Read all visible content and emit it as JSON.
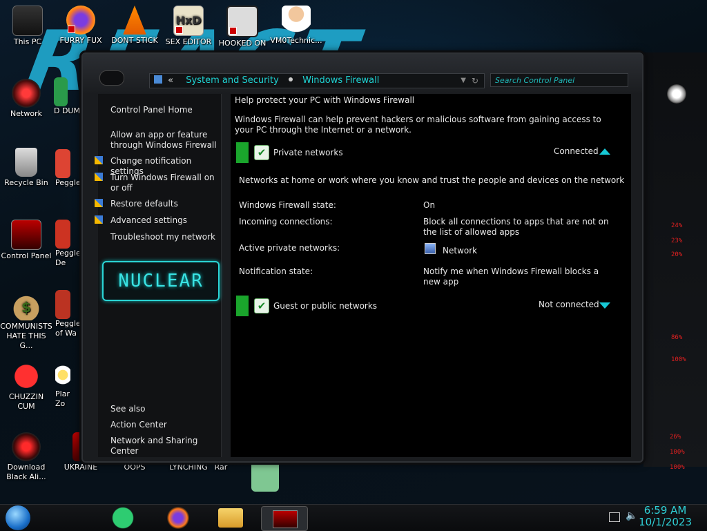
{
  "desktop": {
    "icons": [
      {
        "label": "This PC"
      },
      {
        "label": "FURRY FUX"
      },
      {
        "label": "DONT STICK"
      },
      {
        "label": "SEX EDITOR"
      },
      {
        "label": "HOOKED ON"
      },
      {
        "label": "VM0Technic..."
      },
      {
        "label": "Network"
      },
      {
        "label": "Recycle Bin"
      },
      {
        "label": "Control Panel"
      },
      {
        "label": "COMMUNISTS HATE THIS G..."
      },
      {
        "label": "CHUZZIN CUM"
      },
      {
        "label": "Download Black Ali..."
      },
      {
        "label": "UKRAINE"
      },
      {
        "label": "OOPS"
      },
      {
        "label": "LYNCHING"
      },
      {
        "label": "Rar"
      },
      {
        "label": "D DUM"
      },
      {
        "label": "Peggle"
      },
      {
        "label": "Peggle De"
      },
      {
        "label": "Peggle of Wa"
      },
      {
        "label": "Plar Zo"
      }
    ],
    "wallpaper_graffiti": "REACT"
  },
  "window": {
    "address": {
      "back_chevron": "«",
      "crumb1": "System and Security",
      "crumb2": "Windows Firewall"
    },
    "search_placeholder": "Search Control Panel",
    "sidebar": {
      "home": "Control Panel Home",
      "links": [
        "Allow an app or feature through Windows Firewall",
        "Change notification settings",
        "Turn Windows Firewall on or off",
        "Restore defaults",
        "Advanced settings",
        "Troubleshoot my network"
      ],
      "logo_text": "NUCLEAR",
      "see_also": "See also",
      "see_also_links": [
        "Action Center",
        "Network and Sharing Center"
      ]
    },
    "main": {
      "heading": "Help protect your PC with Windows Firewall",
      "description": "Windows Firewall can help prevent hackers or malicious software from gaining access to your PC through the Internet or a network.",
      "private": {
        "title": "Private networks",
        "status": "Connected",
        "summary": "Networks at home or work where you know and trust the people and devices on the network",
        "rows": [
          {
            "label": "Windows Firewall state:",
            "value": "On"
          },
          {
            "label": "Incoming connections:",
            "value": "Block all connections to apps that are not on the list of allowed apps"
          },
          {
            "label": "Active private networks:",
            "value": "Network"
          },
          {
            "label": "Notification state:",
            "value": "Notify me when Windows Firewall blocks a new app"
          }
        ]
      },
      "public": {
        "title": "Guest or public networks",
        "status": "Not connected"
      }
    }
  },
  "right_widgets": {
    "readouts": [
      "24%",
      "23%",
      "20%",
      "86%",
      "100%",
      "26%",
      "100%",
      "100%"
    ]
  },
  "taskbar": {
    "time": "6:59 AM",
    "date": "10/1/2023",
    "apps": [
      "start-orb",
      "sticky-notes",
      "firefox",
      "file-explorer",
      "control-panel"
    ]
  },
  "colors": {
    "accent": "#1fd3d3",
    "window_bg": "#000000",
    "green_status": "#1aa52c"
  }
}
